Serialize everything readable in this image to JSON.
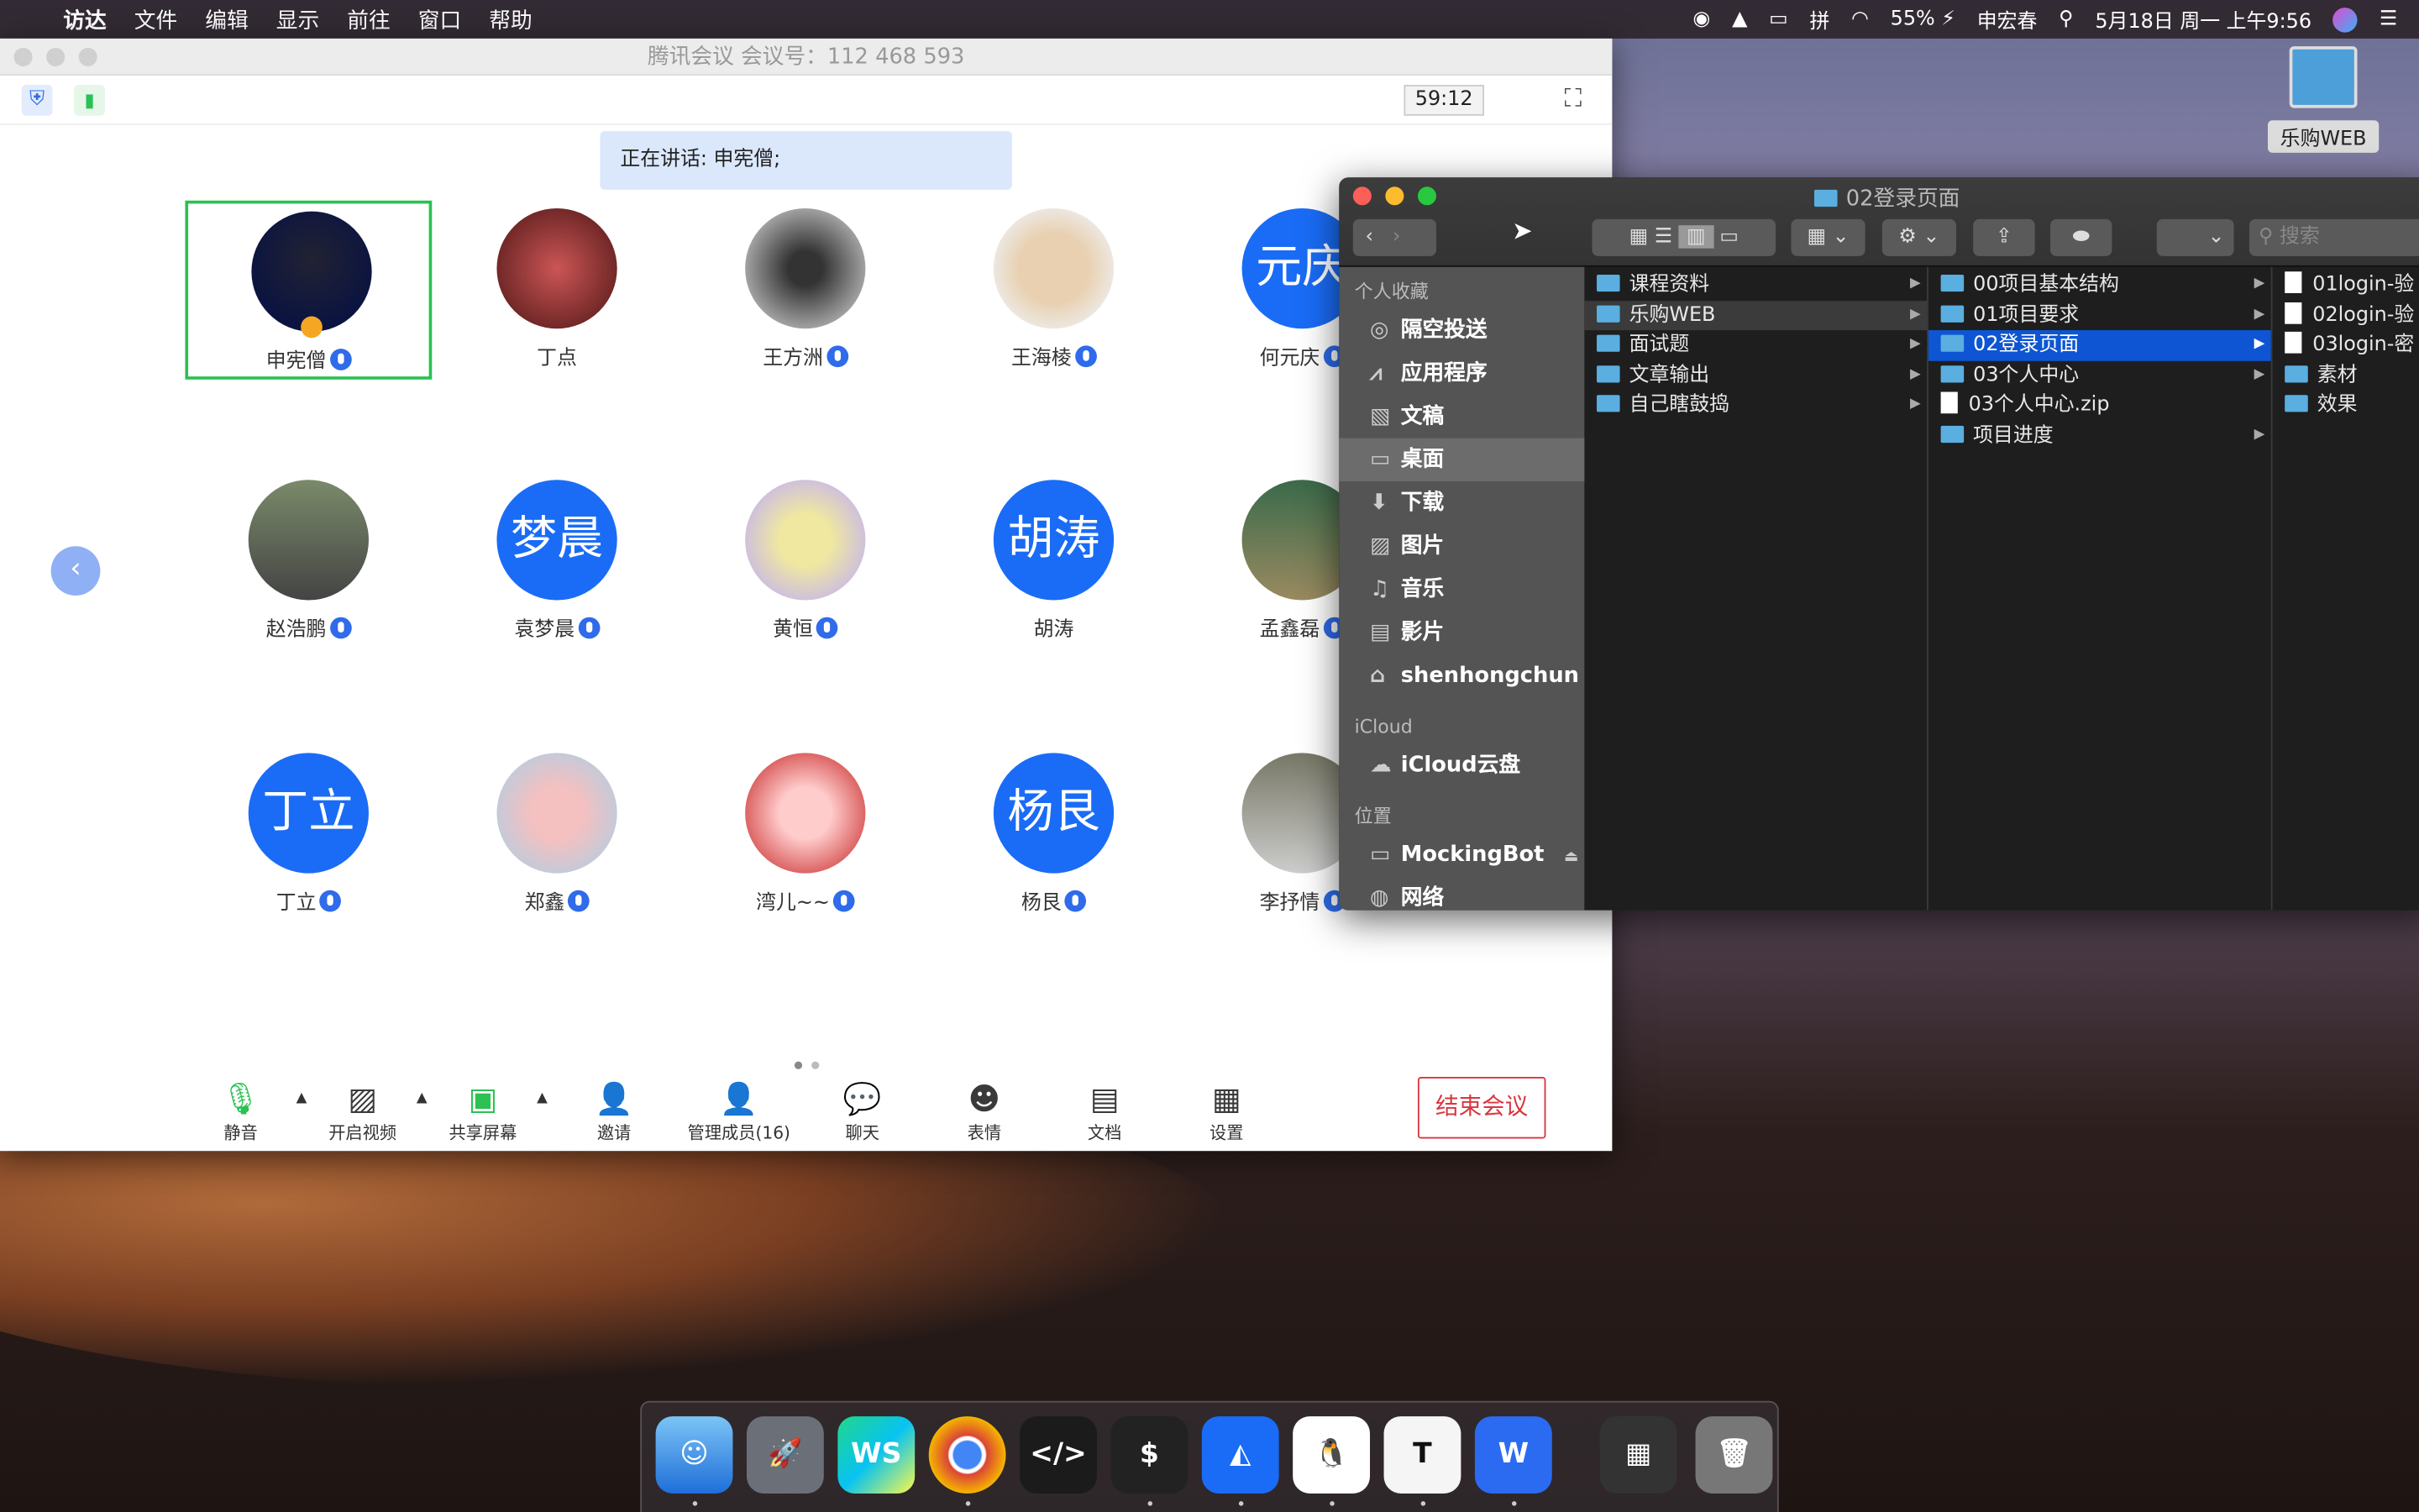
{
  "menubar": {
    "apple": "",
    "items": [
      "访达",
      "文件",
      "编辑",
      "显示",
      "前往",
      "窗口",
      "帮助"
    ],
    "battery": "55%",
    "user": "申宏春",
    "datetime": "5月18日 周一 上午9:56"
  },
  "desktop": {
    "icon_label": "乐购WEB"
  },
  "meeting": {
    "title": "腾讯会议 会议号：112 468 593",
    "timer": "59:12",
    "speaking": "正在讲话: 申宪僧;",
    "participants": [
      {
        "name": "申宪僧",
        "avatar": "photo",
        "mic": true,
        "active": true
      },
      {
        "name": "丁点",
        "avatar": "photo",
        "mic": false
      },
      {
        "name": "王方洲",
        "avatar": "photo",
        "mic": true
      },
      {
        "name": "王海棱",
        "avatar": "photo",
        "mic": true
      },
      {
        "name": "何元庆",
        "avatar": "text",
        "avatar_text": "元庆",
        "mic": true
      },
      {
        "name": "赵浩鹏",
        "avatar": "photo",
        "mic": true
      },
      {
        "name": "袁梦晨",
        "avatar": "text",
        "avatar_text": "梦晨",
        "mic": true
      },
      {
        "name": "黄恒",
        "avatar": "photo",
        "mic": true
      },
      {
        "name": "胡涛",
        "avatar": "text",
        "avatar_text": "胡涛",
        "mic": false
      },
      {
        "name": "孟鑫磊",
        "avatar": "photo",
        "mic": true
      },
      {
        "name": "丁立",
        "avatar": "text",
        "avatar_text": "丁立",
        "mic": true
      },
      {
        "name": "郑鑫",
        "avatar": "photo",
        "mic": true
      },
      {
        "name": "湾儿~~",
        "avatar": "photo",
        "mic": true
      },
      {
        "name": "杨艮",
        "avatar": "text",
        "avatar_text": "杨艮",
        "mic": true
      },
      {
        "name": "李抒情",
        "avatar": "photo",
        "mic": true
      }
    ],
    "controls": [
      "静音",
      "开启视频",
      "共享屏幕",
      "邀请",
      "管理成员(16)",
      "聊天",
      "表情",
      "文档",
      "设置"
    ],
    "end": "结束会议",
    "accent": "#1a6cf6",
    "end_color": "#d9363e"
  },
  "finder": {
    "title": "02登录页面",
    "search_placeholder": "搜索",
    "sidebar": {
      "favorites": "个人收藏",
      "items": [
        "隔空投送",
        "应用程序",
        "文稿",
        "桌面",
        "下载",
        "图片",
        "音乐",
        "影片",
        "shenhongchun"
      ],
      "icloud": "iCloud",
      "icloud_items": [
        "iCloud云盘"
      ],
      "locations": "位置",
      "location_items": [
        "MockingBot",
        "网络"
      ]
    },
    "col1": [
      "课程资料",
      "乐购WEB",
      "面试题",
      "文章输出",
      "自己瞎鼓捣"
    ],
    "col2": [
      "00项目基本结构",
      "01项目要求",
      "02登录页面",
      "03个人中心",
      "03个人中心.zip",
      "项目进度"
    ],
    "col3": [
      "01login-验",
      "02login-验",
      "03login-密",
      "素材",
      "效果"
    ]
  },
  "dock": [
    "访达",
    "启动台",
    "WebStorm",
    "Chrome",
    "编辑器",
    "终端",
    "蓝湖",
    "QQ",
    "Typora",
    "WPS",
    "预览",
    "废纸篓"
  ]
}
